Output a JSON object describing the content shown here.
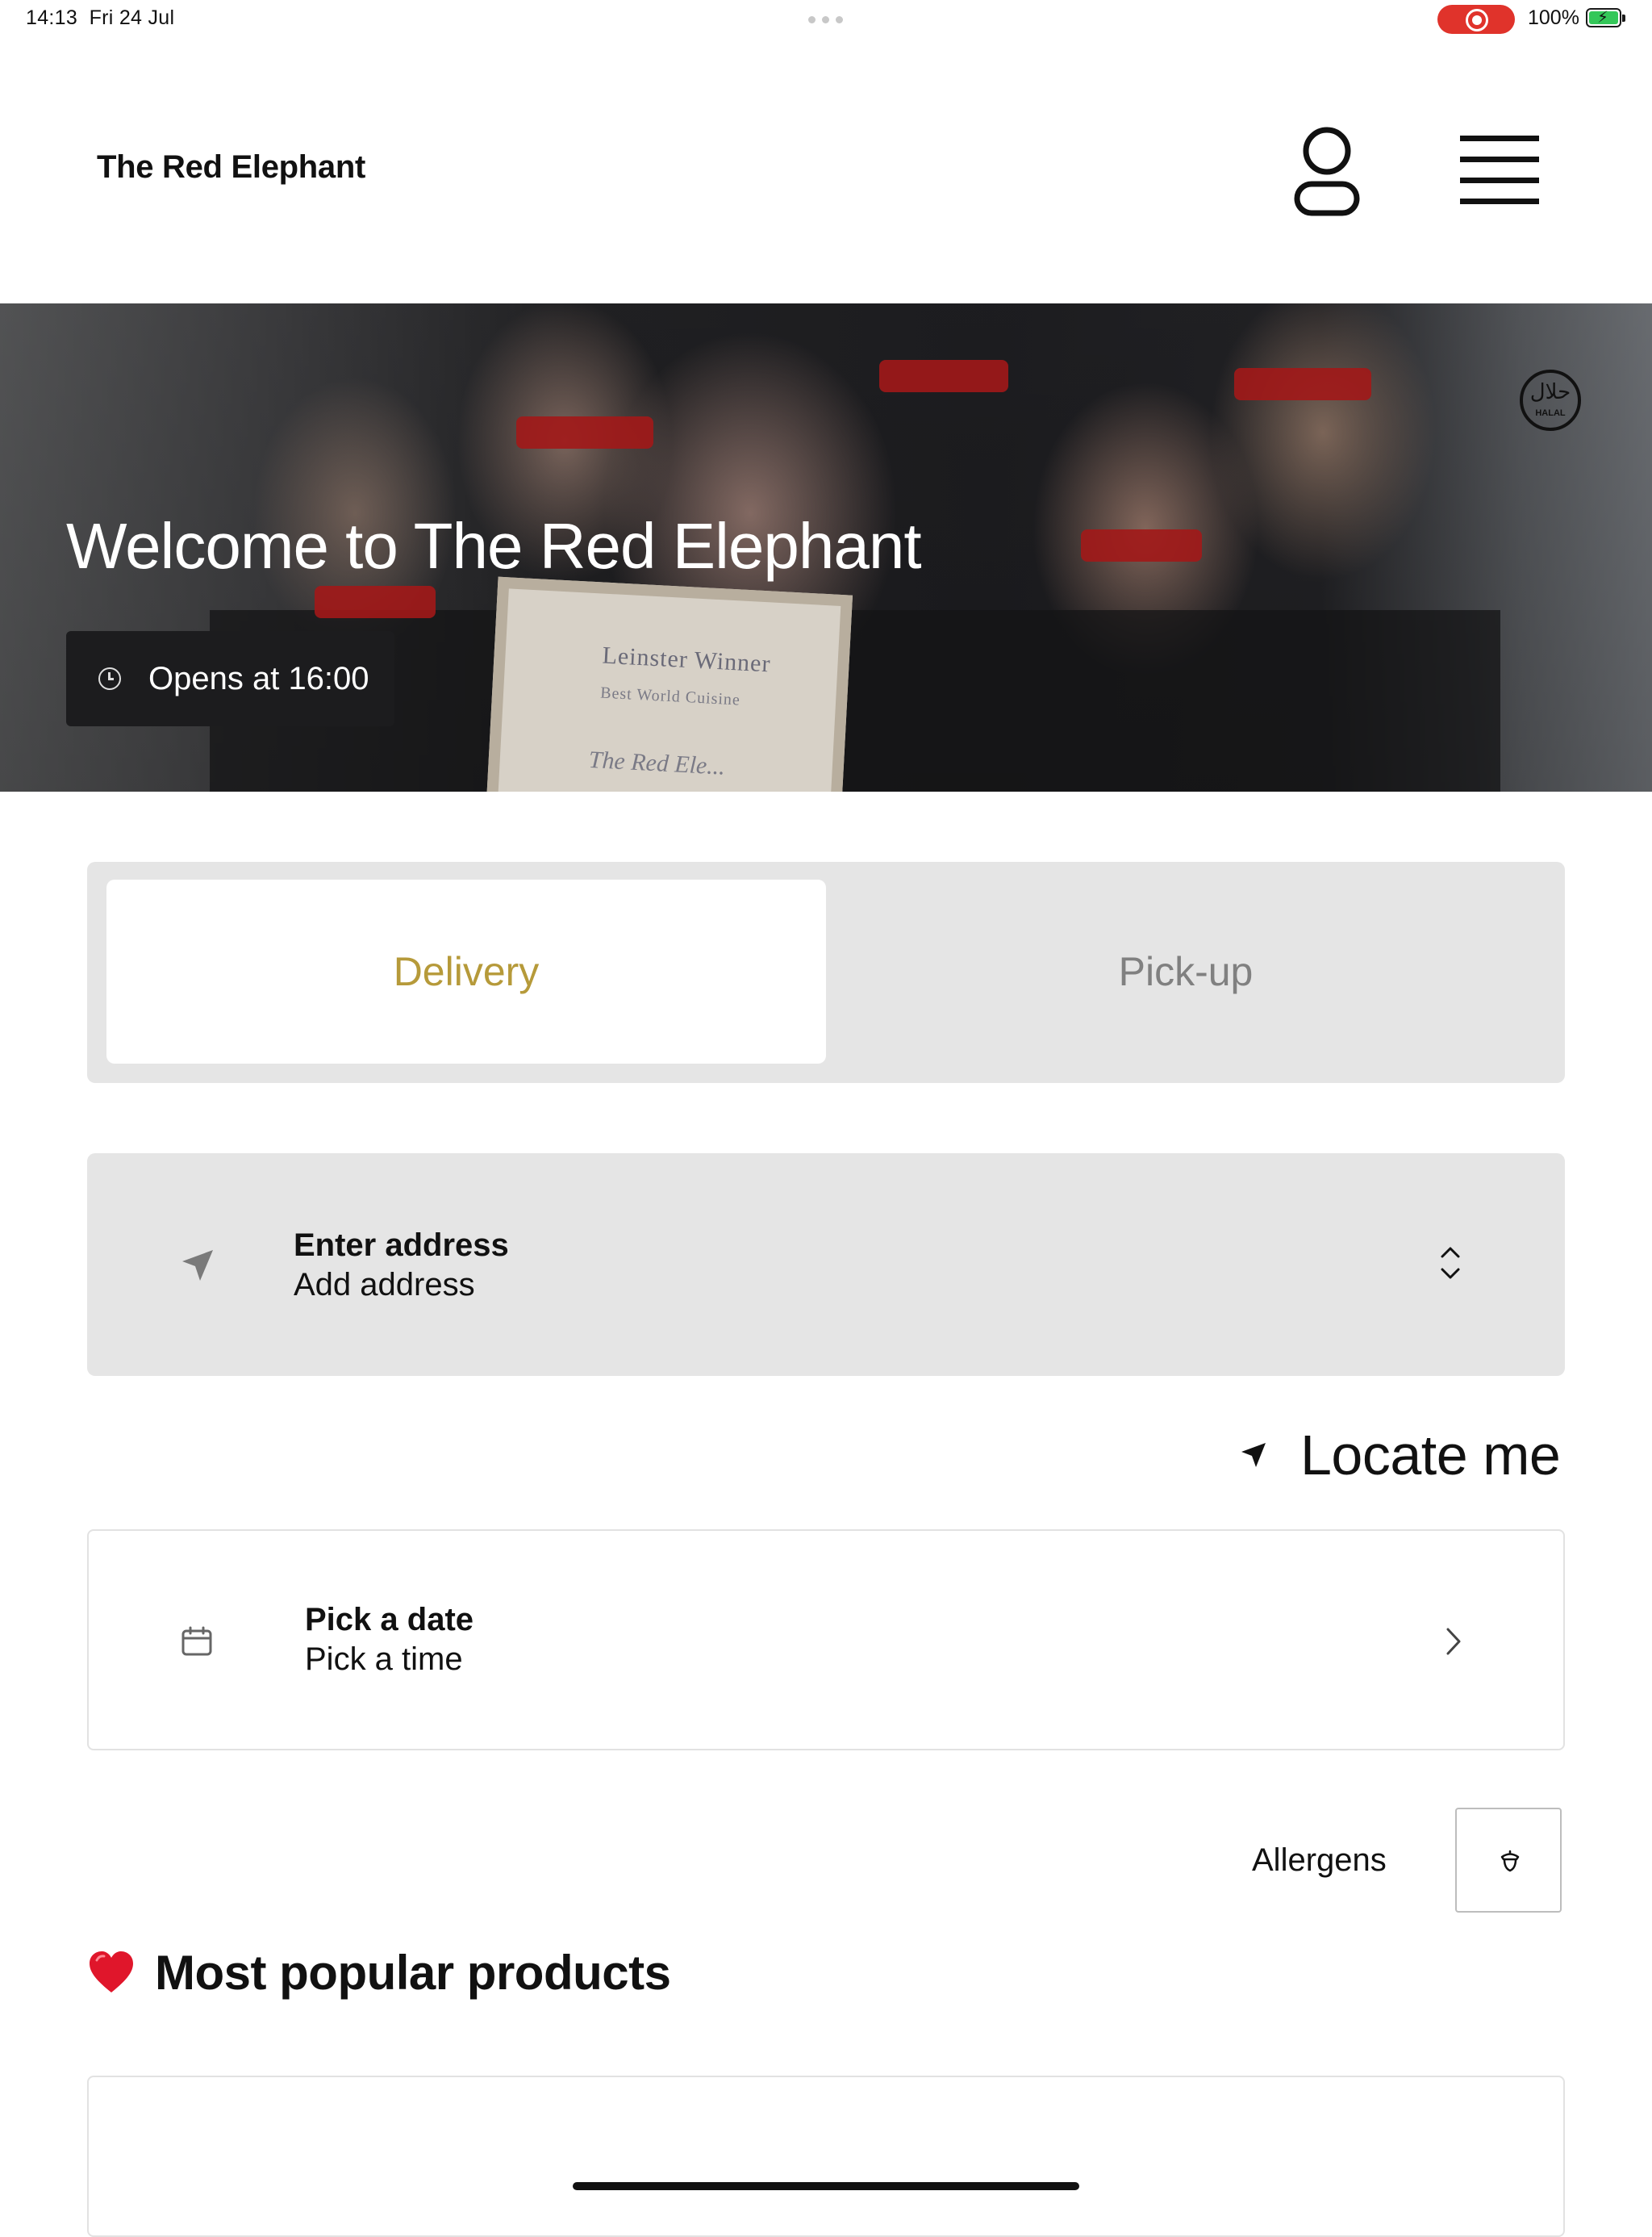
{
  "status_bar": {
    "time": "14:13",
    "date": "Fri 24 Jul",
    "battery_percent": "100%",
    "recording": true
  },
  "header": {
    "brand": "The Red Elephant",
    "user_icon": "user-icon",
    "menu_icon": "hamburger-menu-icon"
  },
  "hero": {
    "title": "Welcome to The Red Elephant",
    "hours": "Opens at 16:00",
    "badge": "HALAL",
    "badge_arabic": "حلال",
    "certificate": {
      "line1": "Leinster Winner",
      "line2": "Best World Cuisine",
      "line3": "The Red Ele..."
    }
  },
  "order_mode": {
    "options": [
      "Delivery",
      "Pick-up"
    ],
    "selected": "Delivery",
    "active_color": "#b69a3a",
    "inactive_color": "#808080"
  },
  "address": {
    "title": "Enter address",
    "subtitle": "Add address"
  },
  "locate": {
    "label": "Locate me"
  },
  "schedule": {
    "title": "Pick a date",
    "subtitle": "Pick a time"
  },
  "allergens": {
    "label": "Allergens",
    "icon": "acorn-icon"
  },
  "popular": {
    "title": "Most popular products",
    "emoji": "heart-icon"
  }
}
